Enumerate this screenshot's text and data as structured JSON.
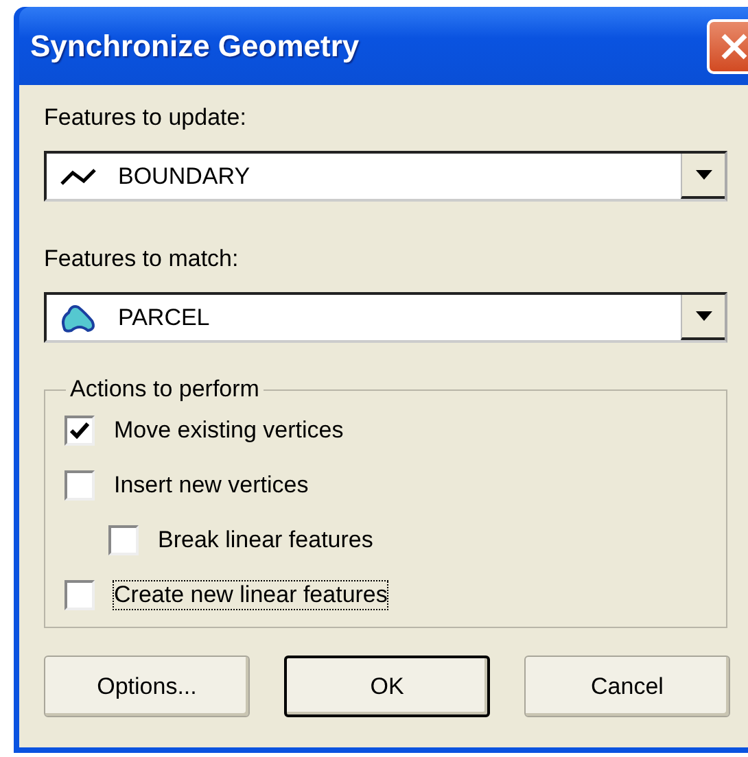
{
  "window": {
    "title": "Synchronize Geometry"
  },
  "fields": [
    {
      "label": "Features to update:",
      "value": "BOUNDARY",
      "kind": "line"
    },
    {
      "label": "Features to match:",
      "value": "PARCEL",
      "kind": "polygon"
    }
  ],
  "actions": {
    "title": "Actions to perform",
    "options": [
      {
        "label": "Move existing vertices",
        "checked": true,
        "focused": false
      },
      {
        "label": "Insert new vertices",
        "checked": false,
        "focused": false,
        "children": [
          {
            "label": "Break linear features",
            "checked": false,
            "focused": false
          }
        ]
      },
      {
        "label": "Create new linear features",
        "checked": false,
        "focused": true
      }
    ]
  },
  "buttons": [
    {
      "label": "Options...",
      "default": false
    },
    {
      "label": "OK",
      "default": true
    },
    {
      "label": "Cancel",
      "default": false
    }
  ]
}
